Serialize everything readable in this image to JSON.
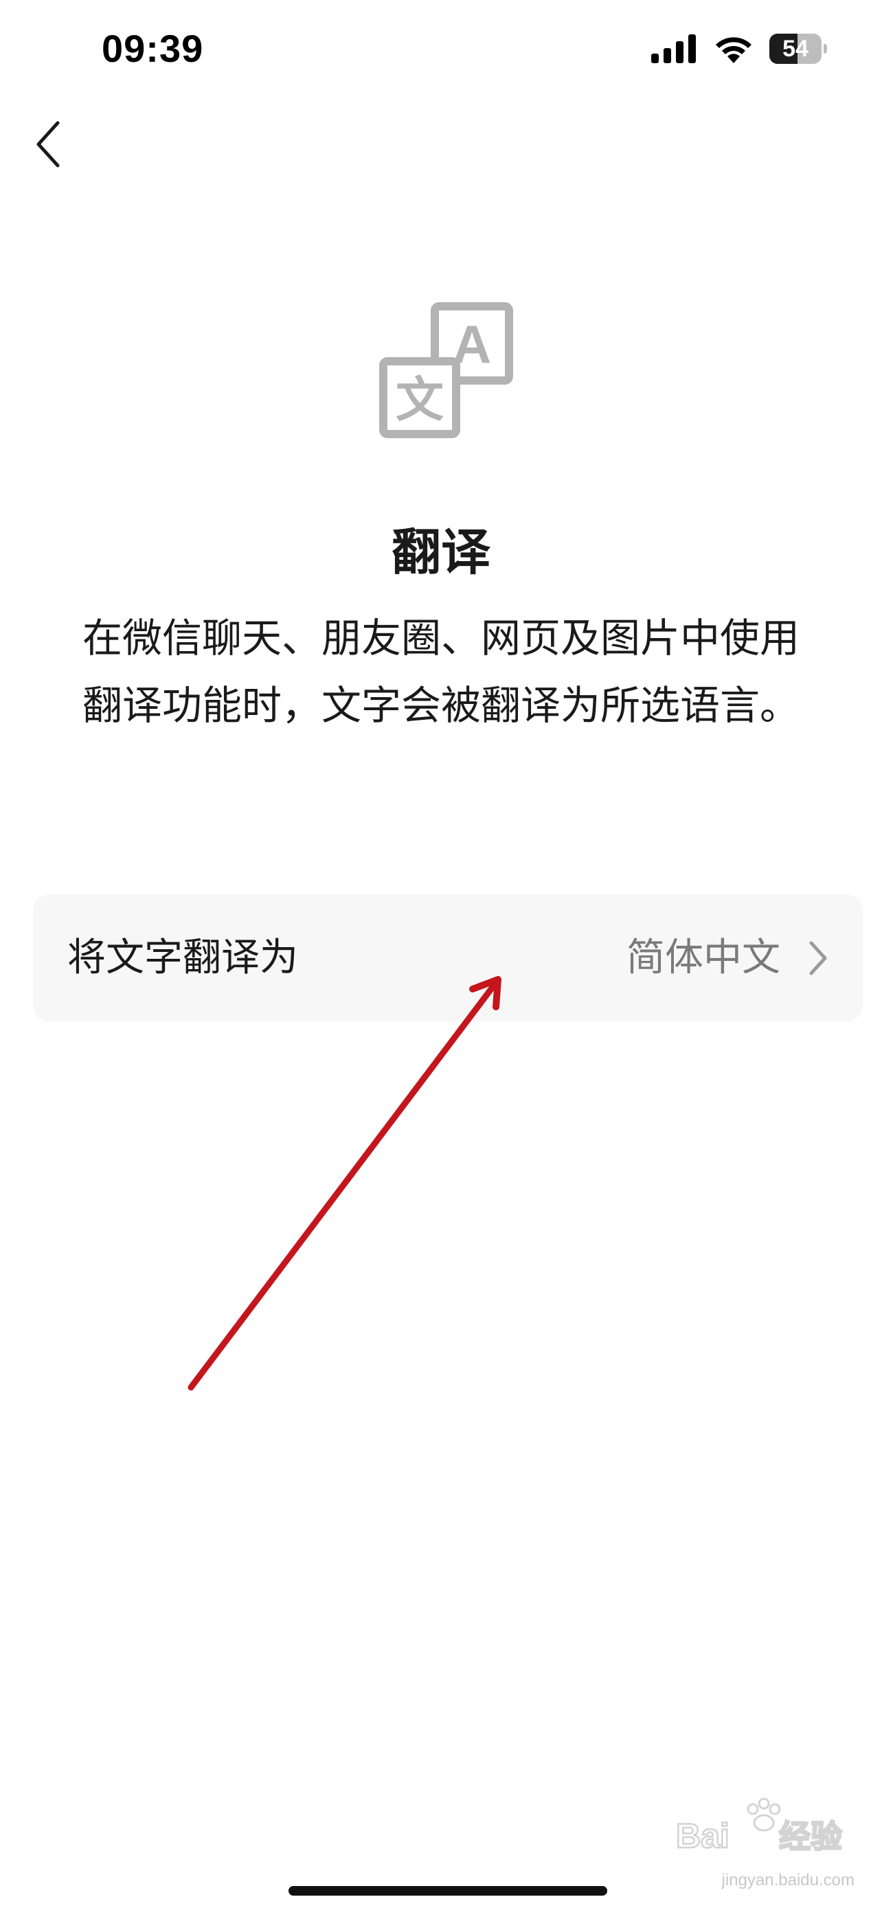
{
  "status_bar": {
    "time": "09:39",
    "battery_level": "54",
    "battery_fraction": 0.54
  },
  "nav": {
    "back_icon": "chevron-left-icon"
  },
  "header": {
    "illustration_icon": "translate-icon",
    "illustration_glyph_front": "文",
    "illustration_glyph_back": "A",
    "title": "翻译",
    "description": "在微信聊天、朋友圈、网页及图片中使用翻译功能时，文字会被翻译为所选语言。"
  },
  "setting": {
    "label": "将文字翻译为",
    "value": "简体中文",
    "chevron_icon": "chevron-right-icon"
  },
  "annotation": {
    "arrow_color": "#c4161c"
  },
  "watermark": {
    "logo_text": "Bai",
    "logo_text_2": "经验",
    "url": "jingyan.baidu.com"
  },
  "colors": {
    "icon_gray": "#b3b3b3",
    "setting_bg": "#f7f7f7",
    "value_gray": "#7a7a7a"
  }
}
